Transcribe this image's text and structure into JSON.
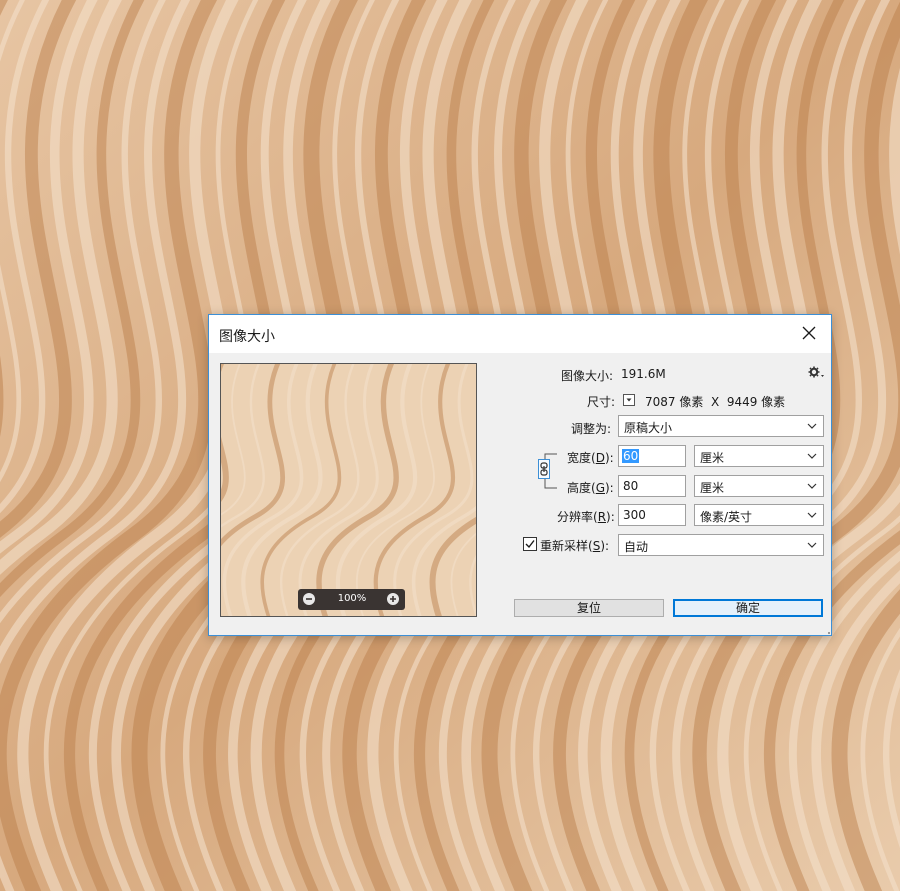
{
  "dialog": {
    "title": "图像大小",
    "image_size_label": "图像大小:",
    "image_size_value": "191.6M",
    "dimensions_label": "尺寸:",
    "dimensions_value": "7087 像素  X  9449 像素",
    "fit_to_label": "调整为:",
    "fit_to_value": "原稿大小",
    "width_label_pre": "宽度(",
    "width_label_key": "D",
    "width_label_post": "):",
    "width_value": "60",
    "width_unit": "厘米",
    "height_label_pre": "高度(",
    "height_label_key": "G",
    "height_label_post": "):",
    "height_value": "80",
    "height_unit": "厘米",
    "resolution_label_pre": "分辨率(",
    "resolution_label_key": "R",
    "resolution_label_post": "):",
    "resolution_value": "300",
    "resolution_unit": "像素/英寸",
    "resample_label_pre": "重新采样(",
    "resample_label_key": "S",
    "resample_label_post": "):",
    "resample_checked": true,
    "resample_value": "自动",
    "reset_button": "复位",
    "ok_button": "确定"
  },
  "preview": {
    "zoom_label": "100%"
  },
  "icons": {
    "close": "close-icon",
    "gear": "gear-icon",
    "dropdown": "chevron-down-icon",
    "link": "chain-link-icon",
    "zoom_out": "zoom-out-icon",
    "zoom_in": "zoom-in-icon",
    "check": "checkmark-icon"
  },
  "colors": {
    "accent": "#0078d7",
    "wood_light": "#f3dfca",
    "wood_dark": "#b87a45"
  }
}
